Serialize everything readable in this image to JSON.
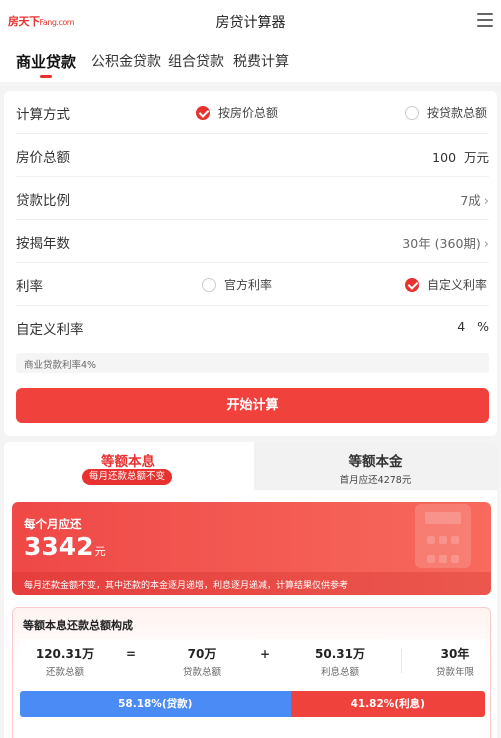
{
  "header": {
    "logo_main": "房天下",
    "logo_sub": "Fang.com",
    "title": "房贷计算器"
  },
  "tabs": [
    {
      "label": "商业贷款",
      "active": true
    },
    {
      "label": "公积金贷款",
      "active": false
    },
    {
      "label": "组合贷款",
      "active": false
    },
    {
      "label": "税费计算",
      "active": false
    }
  ],
  "form": {
    "method": {
      "label": "计算方式",
      "option_a": "按房价总额",
      "option_b": "按贷款总额",
      "selected": "option_a"
    },
    "price": {
      "label": "房价总额",
      "value": "100",
      "unit": "万元"
    },
    "ratio": {
      "label": "贷款比例",
      "value": "7成"
    },
    "years": {
      "label": "按揭年数",
      "value": "30年 (360期)"
    },
    "rate": {
      "label": "利率",
      "option_a": "官方利率",
      "option_b": "自定义利率",
      "selected": "option_b"
    },
    "custom_rate": {
      "label": "自定义利率",
      "value": "4",
      "unit": "%"
    },
    "note": "商业贷款利率4%",
    "calc_button": "开始计算"
  },
  "result": {
    "tab_equal_payment": {
      "title": "等额本息",
      "badge": "每月还款总额不变"
    },
    "tab_equal_principal": {
      "title": "等额本金",
      "subtitle": "首月应还4278元"
    },
    "monthly": {
      "label": "每个月应还",
      "amount": "3342",
      "unit": "元",
      "note": "每月还款金额不变，其中还款的本金逐月递增，利息逐月递减，计算结果仅供参考"
    },
    "breakdown": {
      "title": "等额本息还款总额构成",
      "total": {
        "value": "120.31万",
        "caption": "还款总额"
      },
      "equals": "=",
      "loan": {
        "value": "70万",
        "caption": "贷款总额"
      },
      "plus": "+",
      "interest": {
        "value": "50.31万",
        "caption": "利息总额"
      },
      "term": {
        "value": "30年",
        "caption": "贷款年限"
      }
    },
    "share": {
      "loan_pct": 58.18,
      "interest_pct": 41.82,
      "loan_label": "58.18%(贷款)",
      "interest_label": "41.82%(利息)"
    }
  },
  "colors": {
    "accent": "#e8322f",
    "loan_blue": "#4b8bf5"
  },
  "icons": {
    "menu": "menu-icon",
    "chevron": "chevron-right-icon",
    "check": "check-icon",
    "calculator": "calculator-icon"
  }
}
